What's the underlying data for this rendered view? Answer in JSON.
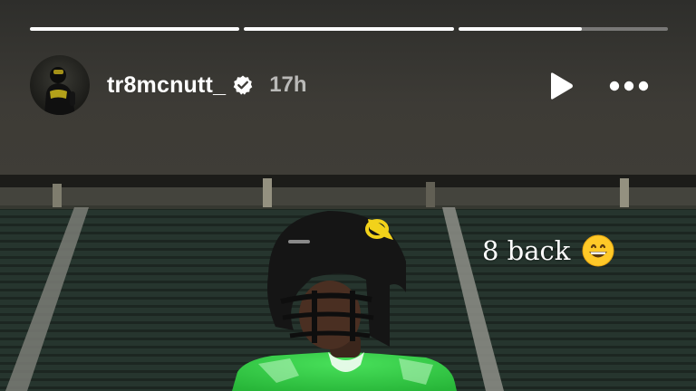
{
  "story": {
    "progress": [
      1.0,
      1.0,
      0.59
    ],
    "username": "tr8mcnutt_",
    "verified": true,
    "time": "17h",
    "caption": "8 back",
    "caption_emoji": "grinning-face-emoji"
  },
  "colors": {
    "header_bg": "#3d3b36",
    "jersey_green": "#39d14a",
    "helmet": "#151515",
    "logo_yellow": "#f2d21a"
  },
  "icons": {
    "verified": "verified-badge-icon",
    "play": "play-icon",
    "more": "more-options-icon"
  }
}
